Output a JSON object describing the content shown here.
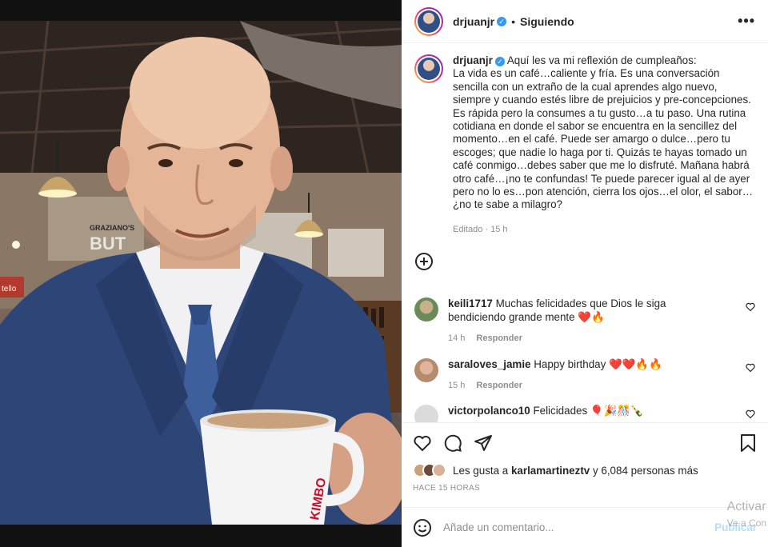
{
  "post": {
    "username": "drjuanjr",
    "follow_status": "Siguiendo",
    "caption_intro": "Aquí les va mi reflexión de cumpleaños:",
    "caption_body": "La vida es un café…caliente y fría. Es una conversación sencilla con un extraño de la cual aprendes algo nuevo, siempre y cuando estés libre de prejuicios y pre-concepciones. Es rápida pero la consumes a tu gusto…a tu paso. Una rutina cotidiana en donde el sabor se encuentra en la sencillez del momento…en el café. Puede ser amargo o dulce…pero tu escoges; que nadie lo haga por ti. Quizás te hayas tomado un café conmigo…debes saber que me lo disfruté. Mañana habrá otro café…¡no te confundas! Te puede parecer igual al de ayer pero no lo es…pon atención, cierra los ojos…el olor, el sabor…¿no te sabe a milagro?",
    "edited_meta": "Editado · 15 h",
    "likes_text_prefix": "Les gusta a",
    "likes_user": "karlamartineztv",
    "likes_text_suffix": "y 6,084 personas más",
    "time_ago": "HACE 15 HORAS",
    "photo_sign_top": "GRAZIANO'S",
    "photo_sign_main": "BUT",
    "photo_sign_left": "tello",
    "cup_brand": "KIMBO"
  },
  "comments": [
    {
      "user": "keili1717",
      "text": "Muchas felicidades que Dios le siga bendiciendo grande mente ❤️🔥",
      "time": "14 h",
      "reply": "Responder"
    },
    {
      "user": "saraloves_jamie",
      "text": "Happy birthday ❤️❤️🔥🔥",
      "time": "15 h",
      "reply": "Responder"
    },
    {
      "user": "victorpolanco10",
      "text": "Felicidades 🎈🎉🎊🍾",
      "time": "",
      "reply": ""
    }
  ],
  "add_comment": {
    "placeholder": "Añade un comentario...",
    "publish": "Publicar"
  },
  "watermark": {
    "line1": "Activar",
    "line2": "Ve a Con"
  },
  "colors": {
    "accent": "#3897f0",
    "heart": "#ed4956",
    "muted": "#8e8e8e"
  }
}
